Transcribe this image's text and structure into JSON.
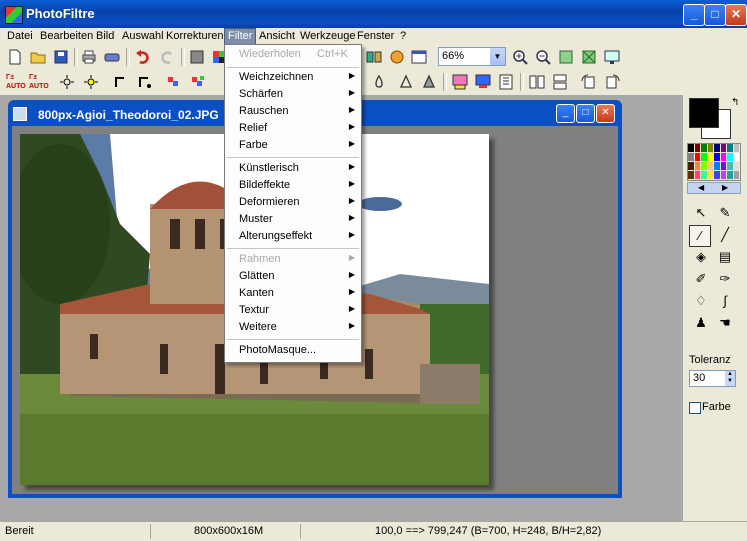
{
  "window": {
    "title": "PhotoFiltre",
    "buttons": {
      "minimize": "_",
      "maximize": "□",
      "close": "✕"
    }
  },
  "menubar": [
    "Datei",
    "Bearbeiten",
    "Bild",
    "Auswahl",
    "Korrekturen",
    "Filter",
    "Ansicht",
    "Werkzeuge",
    "Fenster",
    "?"
  ],
  "active_menu": "Filter",
  "toolbar": {
    "zoom_value": "66%"
  },
  "document": {
    "title": "800px-Agioi_Theodoroi_02.JPG"
  },
  "filter_menu": {
    "undo": {
      "label": "Wiederholen",
      "shortcut": "Ctrl+K"
    },
    "group1": [
      "Weichzeichnen",
      "Schärfen",
      "Rauschen",
      "Relief",
      "Farbe"
    ],
    "group2": [
      "Künstlerisch",
      "Bildeffekte",
      "Deformieren",
      "Muster",
      "Alterungseffekt"
    ],
    "group3_disabled": "Rahmen",
    "group3": [
      "Glätten",
      "Kanten",
      "Textur",
      "Weitere"
    ],
    "photomasque": "PhotoMasque..."
  },
  "right_panel": {
    "tolerance_label": "Toleranz",
    "tolerance_value": "30",
    "color_checkbox_label": "Farbe",
    "color_checkbox_checked": false
  },
  "statusbar": {
    "state": "Bereit",
    "image_info": "800x600x16M",
    "coords": "100,0 ==> 799,247 (B=700, H=248, B/H=2,82)"
  },
  "colors": {
    "titlebar": "#0b4fc4",
    "menu_bg": "#ece9d8",
    "active_menu_bg": "#7c8ea8"
  }
}
